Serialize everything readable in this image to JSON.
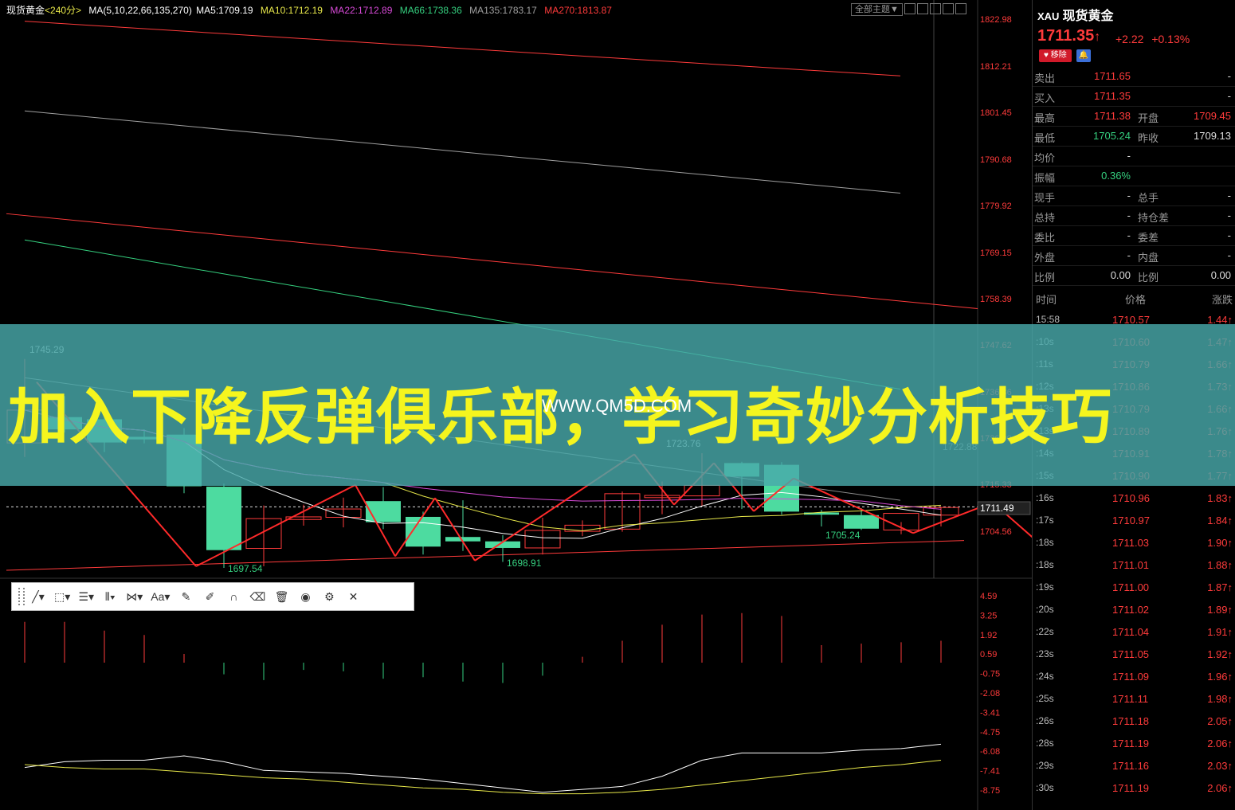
{
  "symbol": {
    "name": "现货黄金",
    "period": "<240分>",
    "code": "XAU",
    "title": "现货黄金"
  },
  "ma_legend": {
    "label": "MA(5,10,22,66,135,270)",
    "ma5": "MA5:1709.19",
    "ma10": "MA10:1712.19",
    "ma22": "MA22:1712.89",
    "ma66": "MA66:1738.36",
    "ma135": "MA135:1783.17",
    "ma270": "MA270:1813.87",
    "colors": {
      "ma5": "#ffffff",
      "ma10": "#e8e84a",
      "ma22": "#d84ad8",
      "ma66": "#35d07f",
      "ma135": "#a0a0a0",
      "ma270": "#ff3b3b"
    }
  },
  "toolbar_top": {
    "theme_label": "全部主题▼"
  },
  "price_axis": [
    "1822.98",
    "1812.21",
    "1801.45",
    "1790.68",
    "1779.92",
    "1769.15",
    "1758.39",
    "1747.62",
    "1736.86",
    "1726.09",
    "1715.33",
    "1711.49",
    "1704.56"
  ],
  "indicator_axis": [
    "4.59",
    "3.25",
    "1.92",
    "0.59",
    "-0.75",
    "-2.08",
    "-3.41",
    "-4.75",
    "-6.08",
    "-7.41",
    "-8.75"
  ],
  "annotations": {
    "high1": "1745.29",
    "low1": "1697.54",
    "low2": "1698.91",
    "high2": "1723.76",
    "low3": "1705.24",
    "right_marker": "1722.88"
  },
  "quote": {
    "price": "1711.35",
    "arrow": "↑",
    "change": "+2.22",
    "change_pct": "+0.13%",
    "remove_label": "移除",
    "bell_icon": "bell-icon",
    "rows": [
      {
        "l1": "卖出",
        "v1": "1711.65",
        "l2": "",
        "v2": "-",
        "c1": "red",
        "c2": "white"
      },
      {
        "l1": "买入",
        "v1": "1711.35",
        "l2": "",
        "v2": "-",
        "c1": "red",
        "c2": "white"
      },
      {
        "l1": "最高",
        "v1": "1711.38",
        "l2": "开盘",
        "v2": "1709.45",
        "c1": "red",
        "c2": "red"
      },
      {
        "l1": "最低",
        "v1": "1705.24",
        "l2": "昨收",
        "v2": "1709.13",
        "c1": "green",
        "c2": "white"
      },
      {
        "l1": "均价",
        "v1": "-",
        "l2": "",
        "v2": "",
        "c1": "white",
        "c2": "white"
      },
      {
        "l1": "振幅",
        "v1": "0.36%",
        "l2": "",
        "v2": "",
        "c1": "green",
        "c2": "white"
      },
      {
        "l1": "现手",
        "v1": "-",
        "l2": "总手",
        "v2": "-",
        "c1": "white",
        "c2": "white"
      },
      {
        "l1": "总持",
        "v1": "-",
        "l2": "持仓差",
        "v2": "-",
        "c1": "white",
        "c2": "white"
      },
      {
        "l1": "委比",
        "v1": "-",
        "l2": "委差",
        "v2": "-",
        "c1": "white",
        "c2": "white"
      },
      {
        "l1": "外盘",
        "v1": "-",
        "l2": "内盘",
        "v2": "-",
        "c1": "white",
        "c2": "white"
      },
      {
        "l1": "比例",
        "v1": "0.00",
        "l2": "比例",
        "v2": "0.00",
        "c1": "white",
        "c2": "white"
      }
    ]
  },
  "ticks_header": {
    "time": "时间",
    "price": "价格",
    "change": "涨跌"
  },
  "ticks": [
    {
      "time": "15:58",
      "price": "1710.57",
      "change": "1.44↑"
    },
    {
      "time": ":10s",
      "price": "1710.60",
      "change": "1.47↑"
    },
    {
      "time": ":11s",
      "price": "1710.79",
      "change": "1.66↑"
    },
    {
      "time": ":12s",
      "price": "1710.86",
      "change": "1.73↑"
    },
    {
      "time": ":13s",
      "price": "1710.79",
      "change": "1.66↑"
    },
    {
      "time": ":13s",
      "price": "1710.89",
      "change": "1.76↑"
    },
    {
      "time": ":14s",
      "price": "1710.91",
      "change": "1.78↑"
    },
    {
      "time": ":15s",
      "price": "1710.90",
      "change": "1.77↑"
    },
    {
      "time": ":16s",
      "price": "1710.96",
      "change": "1.83↑"
    },
    {
      "time": ":17s",
      "price": "1710.97",
      "change": "1.84↑"
    },
    {
      "time": ":18s",
      "price": "1711.03",
      "change": "1.90↑"
    },
    {
      "time": ":18s",
      "price": "1711.01",
      "change": "1.88↑"
    },
    {
      "time": ":19s",
      "price": "1711.00",
      "change": "1.87↑"
    },
    {
      "time": ":20s",
      "price": "1711.02",
      "change": "1.89↑"
    },
    {
      "time": ":22s",
      "price": "1711.04",
      "change": "1.91↑"
    },
    {
      "time": ":23s",
      "price": "1711.05",
      "change": "1.92↑"
    },
    {
      "time": ":24s",
      "price": "1711.09",
      "change": "1.96↑"
    },
    {
      "time": ":25s",
      "price": "1711.11",
      "change": "1.98↑"
    },
    {
      "time": ":26s",
      "price": "1711.18",
      "change": "2.05↑"
    },
    {
      "time": ":28s",
      "price": "1711.19",
      "change": "2.06↑"
    },
    {
      "time": ":29s",
      "price": "1711.16",
      "change": "2.03↑"
    },
    {
      "time": ":30s",
      "price": "1711.19",
      "change": "2.06↑"
    }
  ],
  "draw_toolbar": {
    "text_label": "Aa",
    "icons": [
      "line-tool-icon",
      "shape-tool-icon",
      "fib-tool-icon",
      "channel-tool-icon",
      "pattern-tool-icon",
      "text-tool-icon",
      "ruler-icon",
      "pen-icon",
      "magnet-icon",
      "eraser-icon",
      "trash-icon",
      "eye-icon",
      "gear-icon",
      "close-icon"
    ]
  },
  "banner": {
    "text": "加入下降反弹俱乐部，学习奇妙分析技巧",
    "url": "WWW.QM5D.COM"
  },
  "chart_data": {
    "type": "candlestick",
    "ylim": [
      1697.54,
      1822.98
    ],
    "price_marker": 1711.49,
    "candles": [
      {
        "o": 1726.1,
        "h": 1745.29,
        "l": 1722.9,
        "c": 1733.6
      },
      {
        "o": 1732.0,
        "h": 1736.8,
        "l": 1728.5,
        "c": 1729.2
      },
      {
        "o": 1731.5,
        "h": 1734.8,
        "l": 1724.0,
        "c": 1726.2
      },
      {
        "o": 1727.5,
        "h": 1729.2,
        "l": 1726.0,
        "c": 1726.9
      },
      {
        "o": 1728.0,
        "h": 1729.5,
        "l": 1714.6,
        "c": 1716.2
      },
      {
        "o": 1716.1,
        "h": 1716.8,
        "l": 1697.54,
        "c": 1701.6
      },
      {
        "o": 1702.0,
        "h": 1711.8,
        "l": 1697.9,
        "c": 1708.8
      },
      {
        "o": 1708.6,
        "h": 1712.0,
        "l": 1707.2,
        "c": 1709.2
      },
      {
        "o": 1709.1,
        "h": 1713.6,
        "l": 1706.8,
        "c": 1711.0
      },
      {
        "o": 1712.8,
        "h": 1716.0,
        "l": 1706.4,
        "c": 1708.0
      },
      {
        "o": 1709.2,
        "h": 1710.4,
        "l": 1700.6,
        "c": 1702.4
      },
      {
        "o": 1704.6,
        "h": 1713.0,
        "l": 1701.4,
        "c": 1703.6
      },
      {
        "o": 1703.6,
        "h": 1705.0,
        "l": 1698.91,
        "c": 1702.1
      },
      {
        "o": 1702.1,
        "h": 1709.0,
        "l": 1700.6,
        "c": 1706.1
      },
      {
        "o": 1705.9,
        "h": 1708.4,
        "l": 1704.8,
        "c": 1707.3
      },
      {
        "o": 1706.4,
        "h": 1715.0,
        "l": 1705.8,
        "c": 1714.5
      },
      {
        "o": 1713.6,
        "h": 1717.3,
        "l": 1709.8,
        "c": 1714.1
      },
      {
        "o": 1714.0,
        "h": 1723.76,
        "l": 1711.6,
        "c": 1716.4
      },
      {
        "o": 1721.5,
        "h": 1721.8,
        "l": 1711.0,
        "c": 1718.4
      },
      {
        "o": 1721.1,
        "h": 1721.7,
        "l": 1709.7,
        "c": 1710.4
      },
      {
        "o": 1710.2,
        "h": 1710.8,
        "l": 1707.0,
        "c": 1709.7
      },
      {
        "o": 1709.6,
        "h": 1711.2,
        "l": 1706.2,
        "c": 1706.5
      },
      {
        "o": 1706.2,
        "h": 1708.0,
        "l": 1705.24,
        "c": 1710.0
      },
      {
        "o": 1709.6,
        "h": 1711.38,
        "l": 1707.0,
        "c": 1711.35
      }
    ],
    "indicator": {
      "bars": [
        2.8,
        2.8,
        2.2,
        1.9,
        0.6,
        -0.8,
        -1.2,
        -0.5,
        -0.6,
        -1.1,
        -1.0,
        -1.3,
        -1.4,
        -0.9,
        0.4,
        1.5,
        2.6,
        3.3,
        3.4,
        3.2,
        1.2,
        1.3,
        1.4,
        1.5
      ],
      "line1": [
        -7.2,
        -6.8,
        -6.7,
        -6.7,
        -6.4,
        -6.8,
        -7.4,
        -7.5,
        -7.6,
        -7.8,
        -8.0,
        -8.3,
        -8.6,
        -8.9,
        -8.7,
        -8.5,
        -7.8,
        -6.7,
        -6.2,
        -6.2,
        -6.2,
        -6.0,
        -5.9,
        -5.6
      ],
      "line2": [
        -7.0,
        -7.2,
        -7.3,
        -7.3,
        -7.5,
        -7.7,
        -7.9,
        -8.0,
        -8.2,
        -8.4,
        -8.6,
        -8.7,
        -8.9,
        -9.0,
        -9.0,
        -8.9,
        -8.7,
        -8.4,
        -8.1,
        -7.8,
        -7.5,
        -7.2,
        -7.0,
        -6.7
      ]
    }
  }
}
